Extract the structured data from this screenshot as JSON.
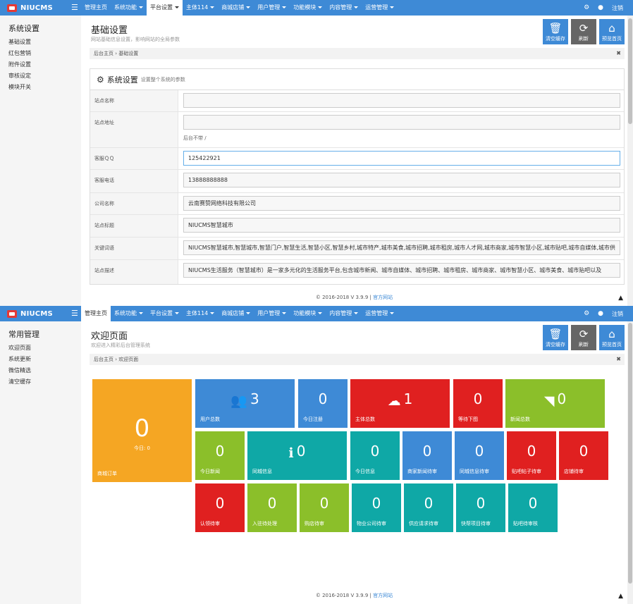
{
  "app_name": "NIUCMS",
  "nav": {
    "items": [
      {
        "label": "管理主页",
        "dropdown": false
      },
      {
        "label": "系统功能",
        "dropdown": true
      },
      {
        "label": "平台设置",
        "dropdown": true
      },
      {
        "label": "主体114",
        "dropdown": true
      },
      {
        "label": "商城店铺",
        "dropdown": true
      },
      {
        "label": "用户管理",
        "dropdown": true
      },
      {
        "label": "功能模块",
        "dropdown": true
      },
      {
        "label": "内容管理",
        "dropdown": true
      },
      {
        "label": "运营管理",
        "dropdown": true
      }
    ],
    "logout": "注销"
  },
  "toolbar": {
    "clear_cache": "清空缓存",
    "refresh": "刷新",
    "preview_home": "预览首页"
  },
  "footer": {
    "copyright": "© 2016-2018 V 3.9.9 |",
    "link": "官方网站"
  },
  "settings_page": {
    "sidebar": {
      "title": "系统设置",
      "items": [
        "基础设置",
        "红包营销",
        "附件设置",
        "审核设定",
        "模块开关"
      ]
    },
    "title": "基础设置",
    "subtitle": "网站基础信息设置，影响网站的全局参数",
    "breadcrumb": "后台主页 › 基础设置",
    "panel_title": "系统设置",
    "panel_subtitle": "设置整个系统的参数",
    "fields": [
      {
        "label": "站点名称",
        "value": ""
      },
      {
        "label": "站点地址",
        "value": "",
        "hint": "后台不带 /"
      },
      {
        "label": "客服ＱＱ",
        "value": "125422921"
      },
      {
        "label": "客服电话",
        "value": "13888888888"
      },
      {
        "label": "公司名称",
        "value": "云南赛赞网络科技有限公司"
      },
      {
        "label": "站点标题",
        "value": "NIUCMS智慧城市"
      },
      {
        "label": "关键词语",
        "value": "NIUCMS智慧城市,智慧城市,智慧门户,智慧生活,智慧小区,智慧乡村,城市特产,城市美食,城市招聘,城市租房,城市人才网,城市商家,城市智慧小区,城市贴吧,城市自媒体,城市供"
      },
      {
        "label": "站点描述",
        "value": "NIUCMS生活服务（智慧城市）是一家多元化的生活服务平台,包含城市新闻、城市自媒体、城市招聘、城市租房、城市商家、城市智慧小区、城市美食、城市贴吧以及"
      }
    ]
  },
  "welcome_page": {
    "sidebar": {
      "title": "常用管理",
      "items": [
        "欢迎页面",
        "系统更新",
        "微信精选",
        "清空缓存"
      ]
    },
    "title": "欢迎页面",
    "subtitle": "欢迎进入精彩后台管理系统",
    "breadcrumb": "后台主页 › 欢迎页面",
    "tiles": [
      {
        "label": "商城订单",
        "value": "0",
        "today": "今日: 0",
        "color": "#f5a623",
        "icon": ""
      },
      {
        "label": "用户总数",
        "value": "3",
        "color": "#3e8ad6",
        "icon": "users-icon"
      },
      {
        "label": "今日注册",
        "value": "0",
        "color": "#3e8ad6",
        "icon": ""
      },
      {
        "label": "主体总数",
        "value": "1",
        "color": "#e02020",
        "icon": "cloud-upload-icon"
      },
      {
        "label": "等待下图",
        "value": "0",
        "color": "#e02020",
        "icon": ""
      },
      {
        "label": "新闻总数",
        "value": "0",
        "color": "#8bbf2a",
        "icon": "rss-icon"
      },
      {
        "label": "今日新闻",
        "value": "0",
        "color": "#8bbf2a",
        "icon": ""
      },
      {
        "label": "同城信息",
        "value": "0",
        "color": "#0fa8a6",
        "icon": "info-icon"
      },
      {
        "label": "今日信息",
        "value": "0",
        "color": "#0fa8a6",
        "icon": ""
      },
      {
        "label": "商家新闻待审",
        "value": "0",
        "color": "#3e8ad6",
        "icon": ""
      },
      {
        "label": "同城信息待审",
        "value": "0",
        "color": "#3e8ad6",
        "icon": ""
      },
      {
        "label": "贴吧帖子待审",
        "value": "0",
        "color": "#e02020",
        "icon": ""
      },
      {
        "label": "店铺待审",
        "value": "0",
        "color": "#e02020",
        "icon": ""
      },
      {
        "label": "认领待审",
        "value": "0",
        "color": "#e02020",
        "icon": ""
      },
      {
        "label": "入驻待处理",
        "value": "0",
        "color": "#8bbf2a",
        "icon": ""
      },
      {
        "label": "购店待审",
        "value": "0",
        "color": "#8bbf2a",
        "icon": ""
      },
      {
        "label": "物业公司待审",
        "value": "0",
        "color": "#0fa8a6",
        "icon": ""
      },
      {
        "label": "供应请求待审",
        "value": "0",
        "color": "#0fa8a6",
        "icon": ""
      },
      {
        "label": "快帮项目待审",
        "value": "0",
        "color": "#0fa8a6",
        "icon": ""
      },
      {
        "label": "贴吧待审核",
        "value": "0",
        "color": "#0fa8a6",
        "icon": ""
      }
    ]
  }
}
